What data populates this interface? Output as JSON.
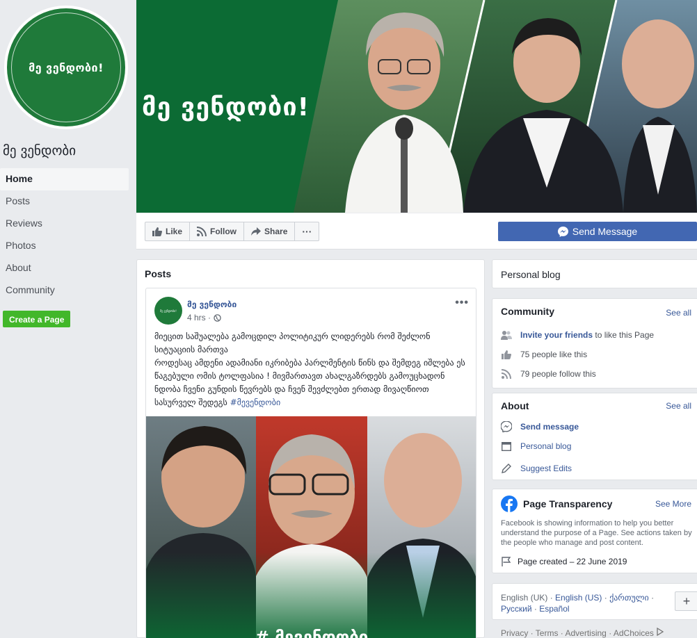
{
  "page": {
    "name": "მე ვენდობი",
    "avatar_text": "მე ვენდობი!",
    "cover_title": "მე ვენდობი!"
  },
  "nav": {
    "items": [
      {
        "label": "Home",
        "active": true
      },
      {
        "label": "Posts"
      },
      {
        "label": "Reviews"
      },
      {
        "label": "Photos"
      },
      {
        "label": "About"
      },
      {
        "label": "Community"
      }
    ],
    "create_page": "Create a Page"
  },
  "actions": {
    "like": "Like",
    "follow": "Follow",
    "share": "Share",
    "more": "···",
    "send_message": "Send Message"
  },
  "posts": {
    "title": "Posts",
    "post": {
      "author": "მე ვენდობი",
      "time": "4 hrs · ",
      "menu": "•••",
      "text": "მიეცით საშუალება გამოცდილ პოლიტიკურ ლიდერებს რომ შეძლონ სიტუაციის მართვა\nროდესაც ამდენი ადამიანი იკრიბება პარლმენტის წინს და შემდეგ იშლება ეს წაგებული ომის ტოლფასია ! მივმართავთ ახალგაზრდებს გამოუცხადონ ნდობა ჩვენი გუნდის წევრებს და ჩვენ შევძლებთ ერთად მივაღწიოთ სასურველ შედეგს ",
      "hashtag": "#მევენდობი",
      "image_caption": "# მევენდობი"
    }
  },
  "right": {
    "personal_blog": "Personal blog",
    "community": {
      "title": "Community",
      "see_all": "See all",
      "invite_link": "Invite your friends",
      "invite_rest": " to like this Page",
      "likes": "75 people like this",
      "follows": "79 people follow this"
    },
    "about": {
      "title": "About",
      "see_all": "See all",
      "send_message": "Send message",
      "category": "Personal blog",
      "suggest_edits": "Suggest Edits"
    },
    "transparency": {
      "title": "Page Transparency",
      "see_more": "See More",
      "desc": "Facebook is showing information to help you better understand the purpose of a Page. See actions taken by the people who manage and post content.",
      "created": "Page created – 22 June 2019"
    },
    "languages": {
      "line1": [
        "English (UK)",
        "English (US)",
        "ქართული"
      ],
      "line2": [
        "Русский",
        "Español"
      ],
      "plus": "+"
    },
    "footer": [
      "Privacy",
      "Terms",
      "Advertising",
      "AdChoices"
    ]
  },
  "colors": {
    "brand_green": "#1f7a3a",
    "fb_blue": "#4267b2",
    "link": "#385898",
    "create_green": "#42b72a"
  }
}
